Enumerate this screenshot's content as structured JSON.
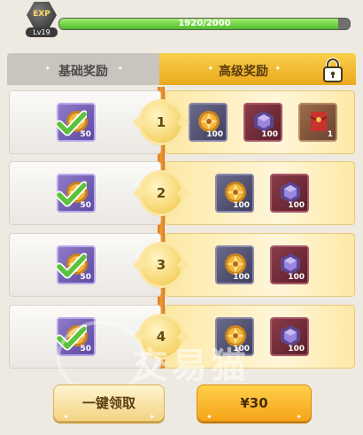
{
  "header": {
    "exp_badge": "EXP",
    "level": "Lv19",
    "progress_text": "1920/2000",
    "progress_fraction": 0.96
  },
  "tabs": {
    "basic": "基础奖励",
    "advanced": "高级奖励",
    "advanced_locked_icon": "lock-icon"
  },
  "rows": [
    {
      "level": "1",
      "basic": {
        "qty": "50",
        "claimed": true,
        "icon": "gold-gem-icon"
      },
      "advanced": [
        {
          "qty": "100",
          "icon": "gold-gem-icon",
          "frame": "slate"
        },
        {
          "qty": "100",
          "icon": "purple-crystal-icon",
          "frame": "crimson"
        },
        {
          "qty": "1",
          "icon": "red-envelope-icon",
          "frame": "brown"
        }
      ]
    },
    {
      "level": "2",
      "basic": {
        "qty": "50",
        "claimed": true,
        "icon": "gold-gem-icon"
      },
      "advanced": [
        {
          "qty": "100",
          "icon": "gold-gem-icon",
          "frame": "slate"
        },
        {
          "qty": "100",
          "icon": "purple-crystal-icon",
          "frame": "crimson"
        }
      ]
    },
    {
      "level": "3",
      "basic": {
        "qty": "50",
        "claimed": true,
        "icon": "gold-gem-icon"
      },
      "advanced": [
        {
          "qty": "100",
          "icon": "gold-gem-icon",
          "frame": "slate"
        },
        {
          "qty": "100",
          "icon": "purple-crystal-icon",
          "frame": "crimson"
        }
      ]
    },
    {
      "level": "4",
      "basic": {
        "qty": "50",
        "claimed": true,
        "icon": "gold-gem-icon"
      },
      "advanced": [
        {
          "qty": "100",
          "icon": "gold-gem-icon",
          "frame": "slate"
        },
        {
          "qty": "100",
          "icon": "purple-crystal-icon",
          "frame": "crimson"
        }
      ]
    }
  ],
  "buttons": {
    "claim_all": "一键领取",
    "buy": "¥30"
  },
  "watermark": "交易猫",
  "colors": {
    "accent_gold": "#f5b72a",
    "progress_green": "#4cbb2c",
    "check_green": "#5cc23b"
  }
}
